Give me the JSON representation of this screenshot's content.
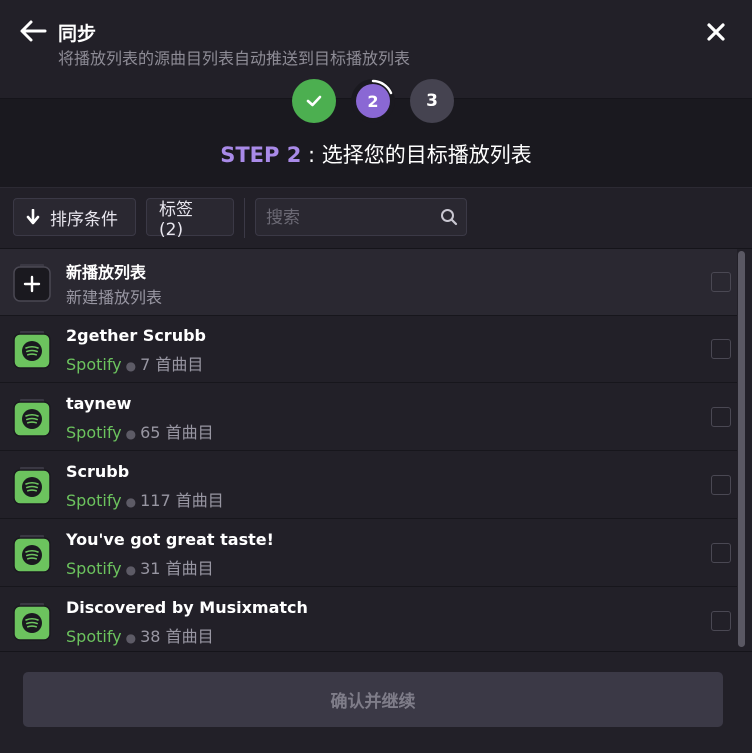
{
  "header": {
    "title": "同步",
    "subtitle": "将播放列表的源曲目列表自动推送到目标播放列表"
  },
  "steps": [
    {
      "number": "1",
      "state": "done",
      "icon": "check-icon"
    },
    {
      "number": "2",
      "state": "active"
    },
    {
      "number": "3",
      "state": "pending"
    }
  ],
  "step_heading": {
    "label": "STEP 2",
    "separator": " : ",
    "text": "选择您的目标播放列表"
  },
  "toolbar": {
    "sort_label": "排序条件",
    "tags_label": "标签 (2)",
    "search_placeholder": "搜索"
  },
  "new_playlist": {
    "title": "新播放列表",
    "subtitle": "新建播放列表"
  },
  "playlists": [
    {
      "name": "2gether Scrubb",
      "platform": "Spotify",
      "tracks": "7 首曲目"
    },
    {
      "name": "taynew",
      "platform": "Spotify",
      "tracks": "65 首曲目"
    },
    {
      "name": "Scrubb",
      "platform": "Spotify",
      "tracks": "117 首曲目"
    },
    {
      "name": "You've got great taste!",
      "platform": "Spotify",
      "tracks": "31 首曲目"
    },
    {
      "name": "Discovered by Musixmatch",
      "platform": "Spotify",
      "tracks": "38 首曲目"
    }
  ],
  "footer": {
    "confirm_label": "确认并继续"
  },
  "colors": {
    "background": "#222028",
    "accent_purple": "#a98ae8",
    "step_done": "#4caf50",
    "spotify_green": "#6cc35e"
  }
}
